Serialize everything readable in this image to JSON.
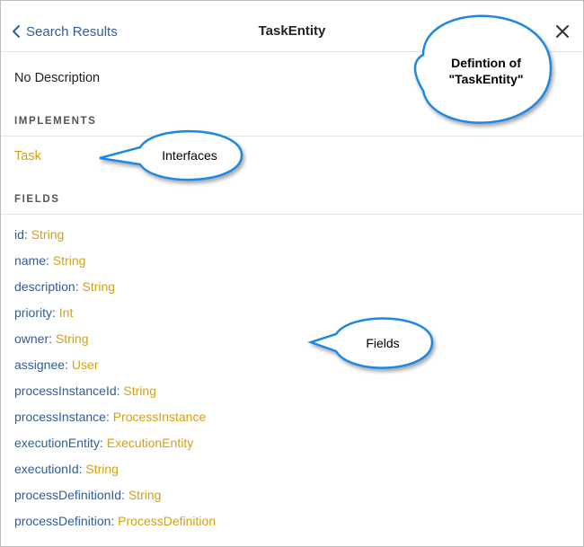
{
  "header": {
    "back_label": "Search Results",
    "title": "TaskEntity"
  },
  "description": "No Description",
  "implements": {
    "heading": "IMPLEMENTS",
    "items": [
      "Task"
    ]
  },
  "fields_section": {
    "heading": "FIELDS",
    "items": [
      {
        "name": "id",
        "type": "String"
      },
      {
        "name": "name",
        "type": "String"
      },
      {
        "name": "description",
        "type": "String"
      },
      {
        "name": "priority",
        "type": "Int"
      },
      {
        "name": "owner",
        "type": "String"
      },
      {
        "name": "assignee",
        "type": "User"
      },
      {
        "name": "processInstanceId",
        "type": "String"
      },
      {
        "name": "processInstance",
        "type": "ProcessInstance"
      },
      {
        "name": "executionEntity",
        "type": "ExecutionEntity"
      },
      {
        "name": "executionId",
        "type": "String"
      },
      {
        "name": "processDefinitionId",
        "type": "String"
      },
      {
        "name": "processDefinition",
        "type": "ProcessDefinition"
      }
    ]
  },
  "callouts": {
    "definition_line1": "Defintion of",
    "definition_line2": "\"TaskEntity\"",
    "interfaces": "Interfaces",
    "fields": "Fields"
  },
  "colors": {
    "link_blue": "#2f5d9b",
    "type_gold": "#d4a017",
    "callout_border": "#1e88e5"
  },
  "icons": {
    "back": "chevron-left-icon",
    "close": "close-icon"
  }
}
